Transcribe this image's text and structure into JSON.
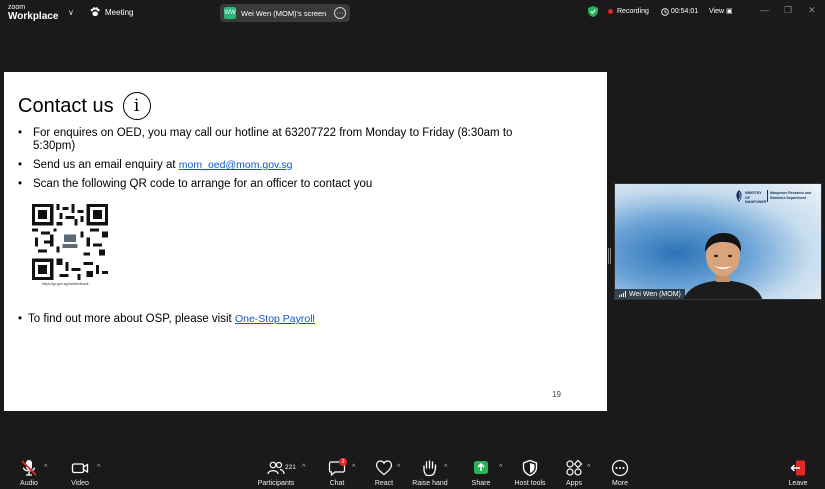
{
  "topbar": {
    "brand_small": "zoom",
    "brand_name": "Workplace",
    "meeting_label": "Meeting",
    "share_title": "Wei Wen (MOM)'s screen",
    "share_avatar": "WW",
    "recording_label": "Recording",
    "timer": "00:54:01",
    "view_label": "View",
    "colors": {
      "recording": "#e02828",
      "secure": "#27b35a",
      "avatar": "#28b47b"
    }
  },
  "slide": {
    "title": "Contact us",
    "info_icon_glyph": "i",
    "bullet_glyph": "•",
    "bullet1": "For enquires on OED, you may call our hotline at 63207722 from Monday to Friday (8:30am to 5:30pm)",
    "bullet2_prefix": "Send us an email enquiry at ",
    "bullet2_link": "mom_oed@mom.gov.sg",
    "bullet3": "Scan the following QR code to arrange for an officer to contact you",
    "qr_caption": "https://go.gov.sg/oedfeedback",
    "bullet4_prefix": "To find out more about OSP, please visit ",
    "bullet4_link": "One-Stop Payroll",
    "page_number": "19",
    "link_color": "#1155cc"
  },
  "video": {
    "participant_name": "Wei Wen (MOM)",
    "org_ministry": "MINISTRY OF MANPOWER",
    "org_dept": "Manpower Research and Statistics Department"
  },
  "toolbar": {
    "items": [
      {
        "label": "Audio",
        "icon": "microphone-muted-icon"
      },
      {
        "label": "Video",
        "icon": "video-camera-icon"
      },
      {
        "label": "Participants",
        "icon": "participants-icon"
      },
      {
        "label": "Chat",
        "icon": "chat-icon"
      },
      {
        "label": "React",
        "icon": "heart-icon"
      },
      {
        "label": "Raise hand",
        "icon": "hand-icon"
      },
      {
        "label": "Share",
        "icon": "share-arrow-icon"
      },
      {
        "label": "Host tools",
        "icon": "shield-icon"
      },
      {
        "label": "Apps",
        "icon": "apps-icon"
      },
      {
        "label": "More",
        "icon": "more-icon"
      },
      {
        "label": "Leave",
        "icon": "leave-icon"
      }
    ],
    "participant_count": "221",
    "chat_badge": "2",
    "caret_glyph": "^",
    "colors": {
      "share": "#27b35a",
      "leave": "#e02828"
    }
  }
}
